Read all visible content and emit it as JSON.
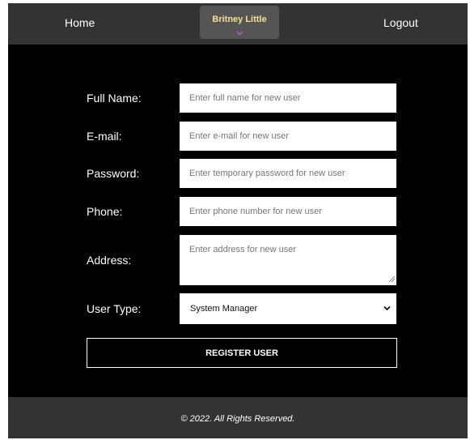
{
  "nav": {
    "home_label": "Home",
    "user_name": "Britney Little",
    "logout_label": "Logout"
  },
  "form": {
    "fields": [
      {
        "label": "Full Name:",
        "placeholder": "Enter full name for new user",
        "value": ""
      },
      {
        "label": "E-mail:",
        "placeholder": "Enter e-mail for new user",
        "value": ""
      },
      {
        "label": "Password:",
        "placeholder": "Enter temporary password for new user",
        "value": ""
      },
      {
        "label": "Phone:",
        "placeholder": "Enter phone number for new user",
        "value": ""
      },
      {
        "label": "Address:",
        "placeholder": "Enter address for new user",
        "value": ""
      }
    ],
    "user_type": {
      "label": "User Type:",
      "selected": "System Manager"
    },
    "submit_label": "REGISTER USER"
  },
  "footer": {
    "text": "© 2022. All Rights Reserved."
  },
  "icons": {
    "user_menu": "chevron-down-icon",
    "select": "chevron-down-icon"
  },
  "colors": {
    "page_background": "#000000",
    "bar_background": "#333333",
    "user_pill_background": "#555555",
    "user_name": "#f4e28a",
    "chevron_accent": "#b86bd6"
  }
}
